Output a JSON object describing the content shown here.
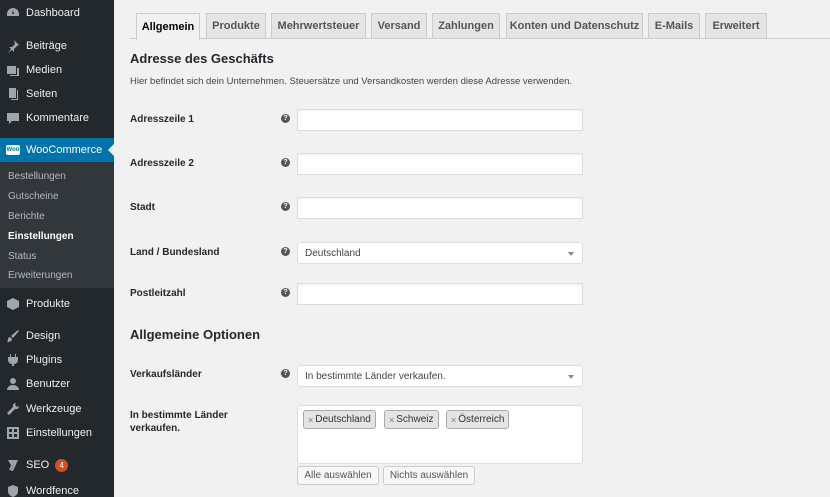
{
  "sidebar": {
    "dashboard": "Dashboard",
    "posts": "Beiträge",
    "media": "Medien",
    "pages": "Seiten",
    "comments": "Kommentare",
    "woocommerce": "WooCommerce",
    "woo_logo_text": "Woo",
    "submenu": {
      "orders": "Bestellungen",
      "coupons": "Gutscheine",
      "reports": "Berichte",
      "settings": "Einstellungen",
      "status": "Status",
      "extensions": "Erweiterungen"
    },
    "products": "Produkte",
    "design": "Design",
    "plugins": "Plugins",
    "users": "Benutzer",
    "tools": "Werkzeuge",
    "settings": "Einstellungen",
    "seo": "SEO",
    "seo_badge": "4",
    "wordfence": "Wordfence"
  },
  "tabs": {
    "general": "Allgemein",
    "products": "Produkte",
    "tax": "Mehrwertsteuer",
    "shipping": "Versand",
    "payments": "Zahlungen",
    "accounts": "Konten und Datenschutz",
    "emails": "E-Mails",
    "advanced": "Erweitert"
  },
  "store_address": {
    "heading": "Adresse des Geschäfts",
    "description": "Hier befindet sich dein Unternehmen. Steuersätze und Versandkosten werden diese Adresse verwenden.",
    "address1_label": "Adresszeile 1",
    "address1_value": "",
    "address2_label": "Adresszeile 2",
    "address2_value": "",
    "city_label": "Stadt",
    "city_value": "",
    "country_label": "Land / Bundesland",
    "country_value": "Deutschland",
    "postcode_label": "Postleitzahl",
    "postcode_value": ""
  },
  "general_options": {
    "heading": "Allgemeine Optionen",
    "selling_label": "Verkaufsländer",
    "selling_value": "In bestimmte Länder verkaufen.",
    "specific_label": "In bestimmte Länder verkaufen.",
    "countries": [
      "Deutschland",
      "Schweiz",
      "Österreich"
    ],
    "chip_remove": "×",
    "select_all": "Alle auswählen",
    "select_none": "Nichts auswählen"
  },
  "help_glyph": "?"
}
